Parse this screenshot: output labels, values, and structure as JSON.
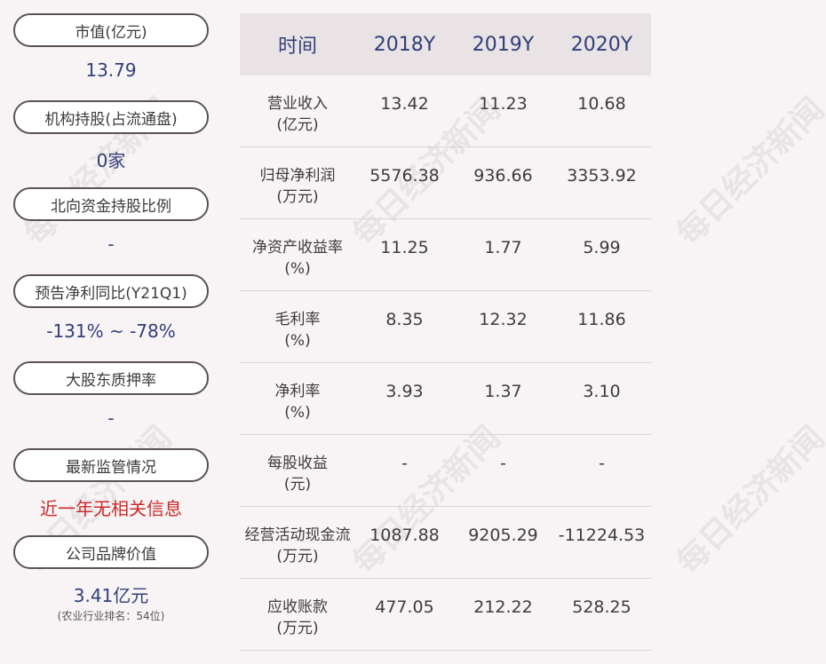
{
  "left_metrics": [
    {
      "label": "市值(亿元)",
      "value": "13.79"
    },
    {
      "label": "机构持股(占流通盘)",
      "value": "0家"
    },
    {
      "label": "北向资金持股比例",
      "value": "-"
    },
    {
      "label": "预告净利同比(Y21Q1)",
      "value": "-131% ~ -78%"
    },
    {
      "label": "大股东质押率",
      "value": "-"
    },
    {
      "label": "最新监管情况",
      "value": "近一年无相关信息"
    },
    {
      "label": "公司品牌价值",
      "value": "3.41亿元",
      "sub": "(农业行业排名：54位)"
    }
  ],
  "table": {
    "header": [
      "时间",
      "2018Y",
      "2019Y",
      "2020Y"
    ],
    "rows": [
      {
        "name": "营业收入",
        "unit": "(亿元)",
        "values": [
          "13.42",
          "11.23",
          "10.68"
        ]
      },
      {
        "name": "归母净利润",
        "unit": "(万元)",
        "values": [
          "5576.38",
          "936.66",
          "3353.92"
        ]
      },
      {
        "name": "净资产收益率",
        "unit": "(%)",
        "values": [
          "11.25",
          "1.77",
          "5.99"
        ]
      },
      {
        "name": "毛利率",
        "unit": "(%)",
        "values": [
          "8.35",
          "12.32",
          "11.86"
        ]
      },
      {
        "name": "净利率",
        "unit": "(%)",
        "values": [
          "3.93",
          "1.37",
          "3.10"
        ]
      },
      {
        "name": "每股收益",
        "unit": "(元)",
        "values": [
          "-",
          "-",
          "-"
        ]
      },
      {
        "name": "经营活动现金流",
        "unit": "(万元)",
        "values": [
          "1087.88",
          "9205.29",
          "-11224.53"
        ]
      },
      {
        "name": "应收账款",
        "unit": "(万元)",
        "values": [
          "477.05",
          "212.22",
          "528.25"
        ]
      }
    ]
  },
  "watermark": "每日经济新闻",
  "colors": {
    "value_blue": "#2f3f7a",
    "alert_red": "#cc2a2a",
    "header_bg": "#e9e3e5"
  }
}
